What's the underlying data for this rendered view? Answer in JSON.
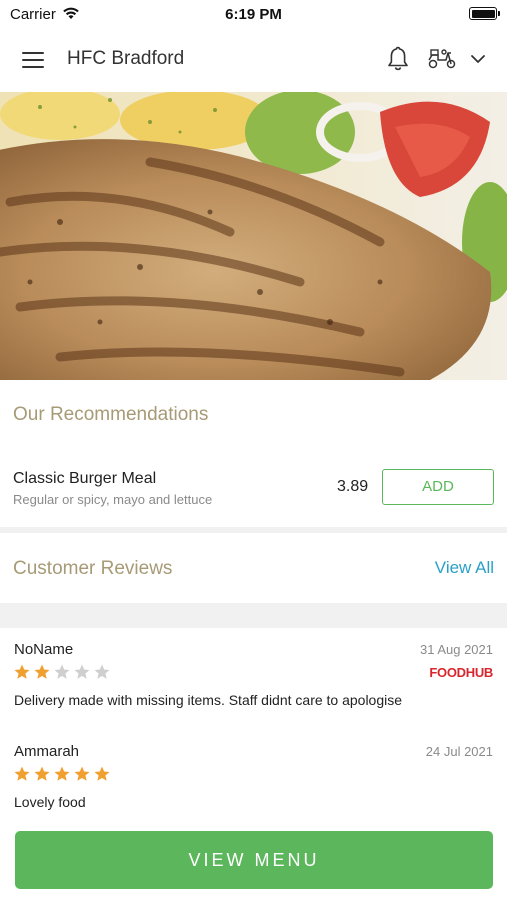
{
  "status_bar": {
    "carrier": "Carrier",
    "time": "6:19 PM"
  },
  "header": {
    "title": "HFC Bradford"
  },
  "recommendations": {
    "title": "Our Recommendations",
    "items": [
      {
        "name": "Classic Burger Meal",
        "description": "Regular or spicy, mayo and lettuce",
        "price": "3.89",
        "add_label": "ADD"
      }
    ]
  },
  "reviews": {
    "title": "Customer Reviews",
    "view_all_label": "View All",
    "items": [
      {
        "name": "NoName",
        "date": "31 Aug 2021",
        "rating": 2,
        "text": "Delivery made with missing items. Staff didnt care to apologise",
        "source": "FOODHUB"
      },
      {
        "name": "Ammarah",
        "date": "24 Jul 2021",
        "rating": 5,
        "text": "Lovely food",
        "source": ""
      }
    ]
  },
  "footer": {
    "view_menu_label": "VIEW MENU"
  },
  "colors": {
    "accent_green": "#5cb75c",
    "section_title": "#a79a76",
    "link_blue": "#2aa0c9",
    "star_filled": "#f0a030",
    "star_empty": "#cfcfcf",
    "foodhub_red": "#d8262e"
  }
}
